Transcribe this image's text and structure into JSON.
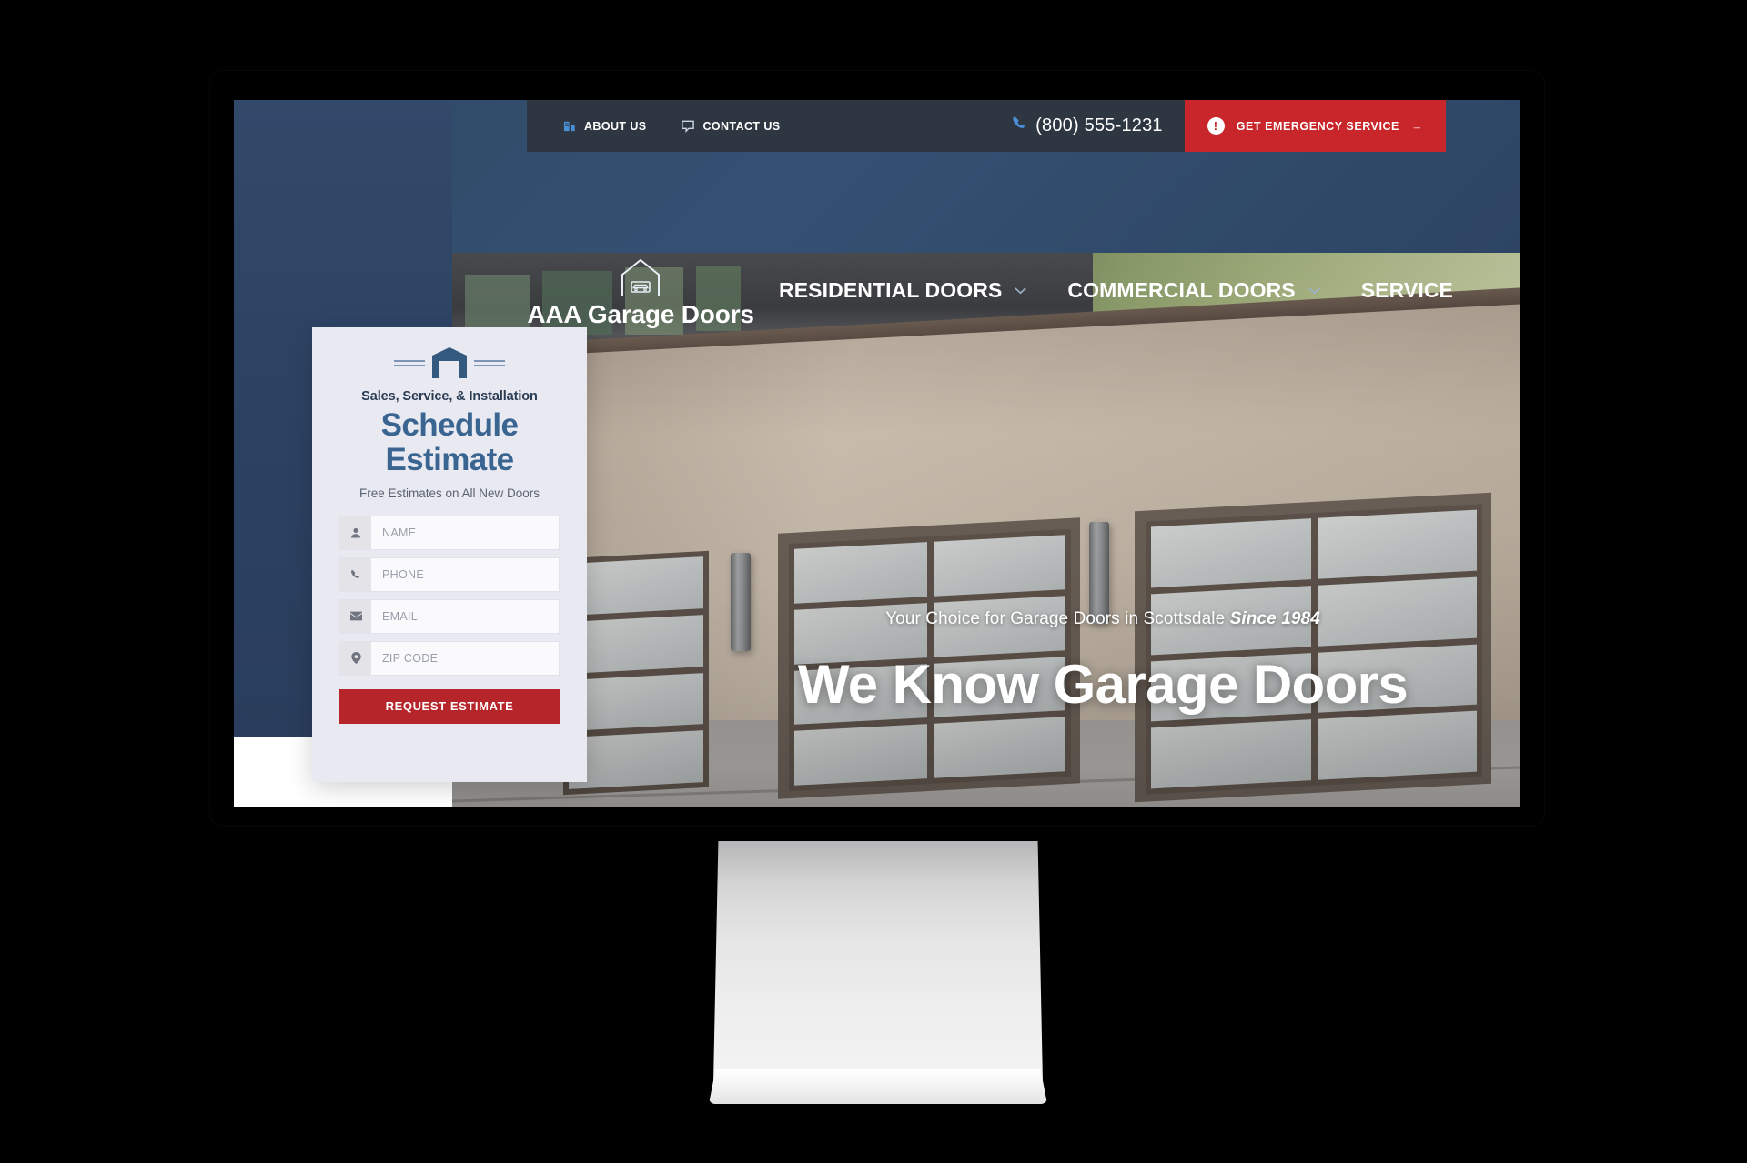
{
  "site": {
    "topbar": {
      "links": [
        {
          "label": "ABOUT US",
          "icon": "building-icon"
        },
        {
          "label": "CONTACT US",
          "icon": "chat-bubble-icon"
        }
      ],
      "phone": "(800) 555-1231",
      "phone_icon": "phone-icon",
      "emergency_label": "GET EMERGENCY SERVICE",
      "emergency_badge": "!",
      "emergency_arrow": "→",
      "emergency_color": "#c8262b",
      "background_color": "#2e3741"
    },
    "brand": {
      "name": "AAA Garage Doors",
      "logo_icon": "house-with-car-icon"
    },
    "nav": [
      {
        "label": "RESIDENTIAL DOORS",
        "has_dropdown": true
      },
      {
        "label": "COMMERCIAL DOORS",
        "has_dropdown": true
      },
      {
        "label": "SERVICE",
        "has_dropdown": false
      }
    ],
    "hero": {
      "subtitle_plain": "Your Choice for Garage Doors in Scottsdale ",
      "subtitle_emphasis": "Since 1984",
      "title": "We Know Garage Doors",
      "header_color": "#2f4a66"
    },
    "estimate_card": {
      "icon": "garage-door-icon",
      "eyebrow": "Sales, Service, & Installation",
      "title_line1": "Schedule",
      "title_line2": "Estimate",
      "note": "Free Estimates on All New Doors",
      "fields": [
        {
          "placeholder": "NAME",
          "icon": "person-icon",
          "value": ""
        },
        {
          "placeholder": "PHONE",
          "icon": "phone-icon",
          "value": ""
        },
        {
          "placeholder": "EMAIL",
          "icon": "envelope-icon",
          "value": ""
        },
        {
          "placeholder": "ZIP CODE",
          "icon": "pin-icon",
          "value": ""
        }
      ],
      "submit_label": "REQUEST ESTIMATE",
      "submit_color": "#b5252a",
      "title_color": "#3a6591"
    }
  }
}
